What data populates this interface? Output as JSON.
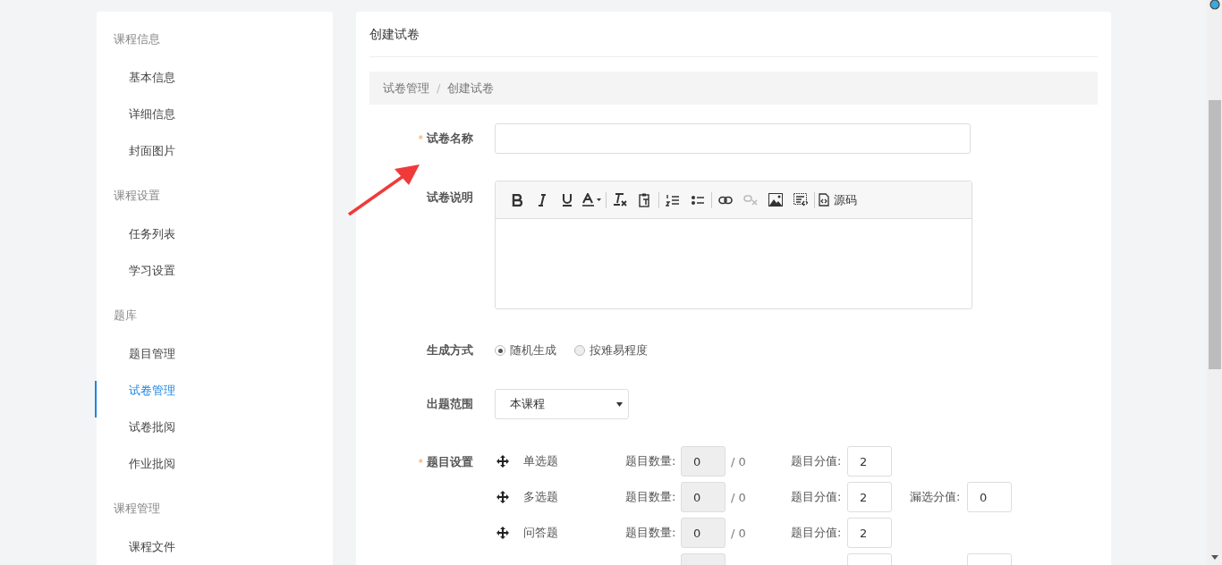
{
  "sidebar": {
    "groups": [
      {
        "title": "课程信息",
        "items": [
          {
            "label": "基本信息",
            "selected": false
          },
          {
            "label": "详细信息",
            "selected": false
          },
          {
            "label": "封面图片",
            "selected": false
          }
        ]
      },
      {
        "title": "课程设置",
        "items": [
          {
            "label": "任务列表",
            "selected": false
          },
          {
            "label": "学习设置",
            "selected": false
          }
        ]
      },
      {
        "title": "题库",
        "items": [
          {
            "label": "题目管理",
            "selected": false
          },
          {
            "label": "试卷管理",
            "selected": true
          },
          {
            "label": "试卷批阅",
            "selected": false
          },
          {
            "label": "作业批阅",
            "selected": false
          }
        ]
      },
      {
        "title": "课程管理",
        "items": [
          {
            "label": "课程文件",
            "selected": false
          }
        ]
      }
    ]
  },
  "page_title": "创建试卷",
  "breadcrumb": [
    "试卷管理",
    "创建试卷"
  ],
  "breadcrumb_separator": "/",
  "form": {
    "name": {
      "label": "试卷名称",
      "required_mark": "*"
    },
    "description": {
      "label": "试卷说明",
      "source_button": "源码"
    },
    "generate": {
      "label": "生成方式",
      "options": [
        {
          "label": "随机生成",
          "selected": true
        },
        {
          "label": "按难易程度",
          "selected": false
        }
      ]
    },
    "range": {
      "label": "出题范围",
      "value": "本课程"
    },
    "questions": {
      "label": "题目设置",
      "required_mark": "*",
      "rows": [
        {
          "kind": "full",
          "label": "单选题",
          "count_label": "题目数量:",
          "count": "0",
          "total": "/ 0",
          "score_label": "题目分值:",
          "score": "2"
        },
        {
          "kind": "full",
          "label": "多选题",
          "count_label": "题目数量:",
          "count": "0",
          "total": "/ 0",
          "score_label": "题目分值:",
          "score": "2",
          "missed_label": "漏选分值:",
          "missed_score": "0"
        },
        {
          "kind": "full",
          "label": "问答题",
          "count_label": "题目数量:",
          "count": "0",
          "total": "/ 0",
          "score_label": "题目分值:",
          "score": "2"
        },
        {
          "kind": "partial"
        }
      ]
    }
  }
}
